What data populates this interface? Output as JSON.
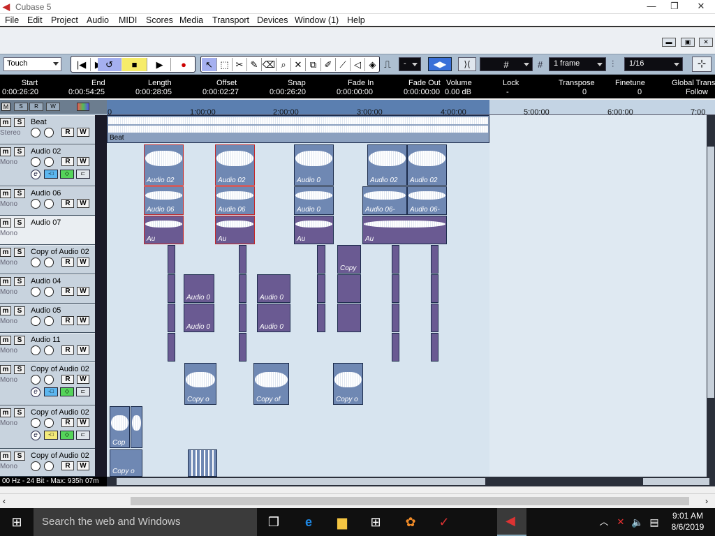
{
  "window": {
    "title": "Cubase 5",
    "min": "—",
    "max": "❐",
    "close": "✕"
  },
  "menu": [
    "File",
    "Edit",
    "Project",
    "Audio",
    "MIDI",
    "Scores",
    "Media",
    "Transport",
    "Devices",
    "Window (1)",
    "Help"
  ],
  "toolbar": {
    "automation_mode": "Touch",
    "snap_value": "-",
    "quantize_label": "1 frame",
    "quantize_value": "1/16"
  },
  "infoline": {
    "headers": [
      "Start",
      "End",
      "Length",
      "Offset",
      "Snap",
      "Fade In",
      "Fade Out",
      "Volume",
      "Lock",
      "Transpose",
      "Finetune",
      "Global Trans"
    ],
    "values": [
      "0:00:26:20",
      "0:00:54:25",
      "0:00:28:05",
      "0:00:02:27",
      "0:00:26:20",
      "0:00:00:00",
      "0:00:00:00",
      "0.00 dB",
      "-",
      "0",
      "0",
      "Follow"
    ]
  },
  "ruler": {
    "ticks": [
      "0",
      "1:00:00",
      "2:00:00",
      "3:00:00",
      "4:00:00",
      "5:00:00",
      "6:00:00",
      "7:00"
    ]
  },
  "tracks": [
    {
      "name": "Beat",
      "channel": "Stereo"
    },
    {
      "name": "Audio 02",
      "channel": "Mono"
    },
    {
      "name": "Audio 06",
      "channel": "Mono"
    },
    {
      "name": "Audio 07",
      "channel": "Mono"
    },
    {
      "name": "Copy of Audio 02",
      "channel": "Mono"
    },
    {
      "name": "Audio 04",
      "channel": "Mono"
    },
    {
      "name": "Audio 05",
      "channel": "Mono"
    },
    {
      "name": "Audio 11",
      "channel": "Mono"
    },
    {
      "name": "Copy of Audio 02",
      "channel": "Mono"
    },
    {
      "name": "Copy of Audio 02",
      "channel": "Mono"
    },
    {
      "name": "Copy of Audio 02",
      "channel": "Mono"
    }
  ],
  "parts": {
    "beat": "Beat",
    "a02": "Audio 02",
    "a02s": "Audio 0",
    "a06": "Audio 06",
    "a06s": "Audio 0",
    "a06b": "Audio 06-",
    "a07s": "Au",
    "a04": "Audio 0",
    "copy": "Copy",
    "copyof": "Copy of",
    "copyo": "Copy o",
    "cop": "Cop"
  },
  "status": {
    "format": "00 Hz - 24 Bit - Max: 935h 07m"
  },
  "taskbar": {
    "search_placeholder": "Search the web and Windows",
    "time": "9:01 AM",
    "date": "8/6/2019"
  }
}
